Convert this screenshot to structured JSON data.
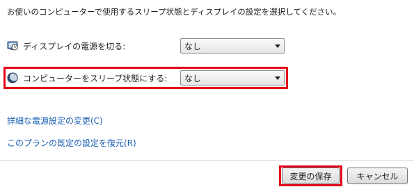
{
  "description": "お使いのコンピューターで使用するスリープ状態とディスプレイの設定を選択してください。",
  "settings": [
    {
      "label": "ディスプレイの電源を切る:",
      "value": "なし",
      "icon": "monitor-clock-icon"
    },
    {
      "label": "コンピューターをスリープ状態にする:",
      "value": "なし",
      "icon": "moon-icon"
    }
  ],
  "links": {
    "advanced": "詳細な電源設定の変更(C)",
    "restore": "このプランの既定の設定を復元(R)"
  },
  "buttons": {
    "save": "変更の保存",
    "cancel": "キャンセル"
  },
  "colors": {
    "highlight": "#e3001b",
    "link": "#1a5fb4"
  }
}
